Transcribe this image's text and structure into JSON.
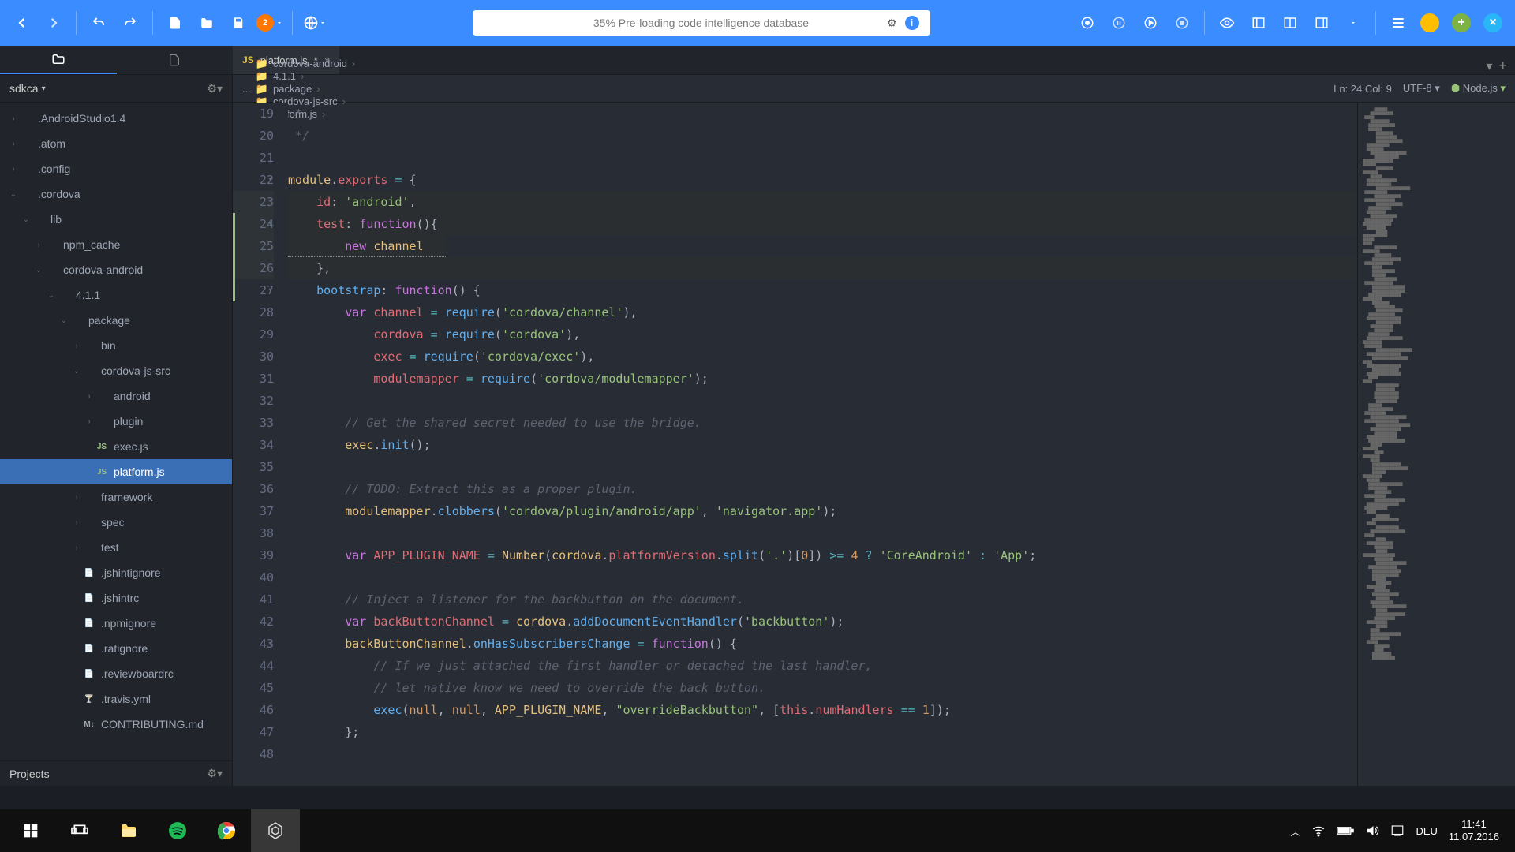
{
  "toolbar": {
    "loading_text": "35% Pre-loading code intelligence database",
    "update_badge": "2"
  },
  "tabs": {
    "file_name": "platform.js",
    "modified_marker": "*"
  },
  "sidebar": {
    "project_label": "sdkca",
    "footer_label": "Projects",
    "items": [
      {
        "label": ".AndroidStudio1.4",
        "depth": 0,
        "chev": "›",
        "icon": ""
      },
      {
        "label": ".atom",
        "depth": 0,
        "chev": "›",
        "icon": ""
      },
      {
        "label": ".config",
        "depth": 0,
        "chev": "›",
        "icon": ""
      },
      {
        "label": ".cordova",
        "depth": 0,
        "chev": "⌄",
        "icon": ""
      },
      {
        "label": "lib",
        "depth": 1,
        "chev": "⌄",
        "icon": ""
      },
      {
        "label": "npm_cache",
        "depth": 2,
        "chev": "›",
        "icon": ""
      },
      {
        "label": "cordova-android",
        "depth": 2,
        "chev": "⌄",
        "icon": ""
      },
      {
        "label": "4.1.1",
        "depth": 3,
        "chev": "⌄",
        "icon": ""
      },
      {
        "label": "package",
        "depth": 4,
        "chev": "⌄",
        "icon": ""
      },
      {
        "label": "bin",
        "depth": 5,
        "chev": "›",
        "icon": ""
      },
      {
        "label": "cordova-js-src",
        "depth": 5,
        "chev": "⌄",
        "icon": ""
      },
      {
        "label": "android",
        "depth": 6,
        "chev": "›",
        "icon": ""
      },
      {
        "label": "plugin",
        "depth": 6,
        "chev": "›",
        "icon": ""
      },
      {
        "label": "exec.js",
        "depth": 6,
        "chev": "",
        "icon": "JS",
        "iconColor": "#98c379"
      },
      {
        "label": "platform.js",
        "depth": 6,
        "chev": "",
        "icon": "JS",
        "iconColor": "#98c379",
        "selected": true
      },
      {
        "label": "framework",
        "depth": 5,
        "chev": "›",
        "icon": ""
      },
      {
        "label": "spec",
        "depth": 5,
        "chev": "›",
        "icon": ""
      },
      {
        "label": "test",
        "depth": 5,
        "chev": "›",
        "icon": ""
      },
      {
        "label": ".jshintignore",
        "depth": 5,
        "chev": "",
        "icon": "📄"
      },
      {
        "label": ".jshintrc",
        "depth": 5,
        "chev": "",
        "icon": "📄"
      },
      {
        "label": ".npmignore",
        "depth": 5,
        "chev": "",
        "icon": "📄"
      },
      {
        "label": ".ratignore",
        "depth": 5,
        "chev": "",
        "icon": "📄"
      },
      {
        "label": ".reviewboardrc",
        "depth": 5,
        "chev": "",
        "icon": "📄"
      },
      {
        "label": ".travis.yml",
        "depth": 5,
        "chev": "",
        "icon": "🍸",
        "iconColor": "#e06c75"
      },
      {
        "label": "CONTRIBUTING.md",
        "depth": 5,
        "chev": "",
        "icon": "M↓"
      }
    ]
  },
  "breadcrumb": {
    "segments": [
      "cordova-android",
      "4.1.1",
      "package",
      "cordova-js-src",
      "platform.js"
    ],
    "cursor_info": "Ln: 24 Col: 9",
    "encoding": "UTF-8",
    "language": "Node.js"
  },
  "editor": {
    "first_line": 19,
    "lines": [
      {
        "n": 19,
        "html": "<span class='com'> *</span>"
      },
      {
        "n": 20,
        "html": "<span class='com'> */</span>"
      },
      {
        "n": 21,
        "html": ""
      },
      {
        "n": 22,
        "fold": true,
        "html": "<span class='var2'>module</span>.<span class='prop'>exports</span> <span class='op'>=</span> {"
      },
      {
        "n": 23,
        "mod": true,
        "html": "    <span class='prop'>id</span>: <span class='str'>'android'</span>,"
      },
      {
        "n": 24,
        "fold": true,
        "mod": true,
        "cursor": true,
        "html": "    <span class='prop'>test</span>: <span class='kw'>function</span>(){"
      },
      {
        "n": 25,
        "mod": true,
        "underline": true,
        "html": "        <span class='kw'>new</span> <span class='var2'>channel</span>"
      },
      {
        "n": 26,
        "mod": true,
        "html": "    },"
      },
      {
        "n": 27,
        "fold": true,
        "html": "    <span class='fn'>bootstrap</span>: <span class='kw'>function</span>() {"
      },
      {
        "n": 28,
        "html": "        <span class='kw'>var</span> <span class='prop'>channel</span> <span class='op'>=</span> <span class='fn'>require</span>(<span class='str'>'cordova/channel'</span>),"
      },
      {
        "n": 29,
        "html": "            <span class='prop'>cordova</span> <span class='op'>=</span> <span class='fn'>require</span>(<span class='str'>'cordova'</span>),"
      },
      {
        "n": 30,
        "html": "            <span class='prop'>exec</span> <span class='op'>=</span> <span class='fn'>require</span>(<span class='str'>'cordova/exec'</span>),"
      },
      {
        "n": 31,
        "html": "            <span class='prop'>modulemapper</span> <span class='op'>=</span> <span class='fn'>require</span>(<span class='str'>'cordova/modulemapper'</span>);"
      },
      {
        "n": 32,
        "html": ""
      },
      {
        "n": 33,
        "html": "        <span class='com'>// Get the shared secret needed to use the bridge.</span>"
      },
      {
        "n": 34,
        "html": "        <span class='var2'>exec</span>.<span class='fn'>init</span>();"
      },
      {
        "n": 35,
        "html": ""
      },
      {
        "n": 36,
        "html": "        <span class='com'>// TODO: Extract this as a proper plugin.</span>"
      },
      {
        "n": 37,
        "html": "        <span class='var2'>modulemapper</span>.<span class='fn'>clobbers</span>(<span class='str'>'cordova/plugin/android/app'</span>, <span class='str'>'navigator.app'</span>);"
      },
      {
        "n": 38,
        "html": ""
      },
      {
        "n": 39,
        "html": "        <span class='kw'>var</span> <span class='prop'>APP_PLUGIN_NAME</span> <span class='op'>=</span> <span class='var2'>Number</span>(<span class='var2'>cordova</span>.<span class='prop'>platformVersion</span>.<span class='fn'>split</span>(<span class='str'>'.'</span>)[<span class='num'>0</span>]) <span class='op'>&gt;=</span> <span class='num'>4</span> <span class='op'>?</span> <span class='str'>'CoreAndroid'</span> <span class='op'>:</span> <span class='str'>'App'</span>;"
      },
      {
        "n": 40,
        "html": ""
      },
      {
        "n": 41,
        "html": "        <span class='com'>// Inject a listener for the backbutton on the document.</span>"
      },
      {
        "n": 42,
        "html": "        <span class='kw'>var</span> <span class='prop'>backButtonChannel</span> <span class='op'>=</span> <span class='var2'>cordova</span>.<span class='fn'>addDocumentEventHandler</span>(<span class='str'>'backbutton'</span>);"
      },
      {
        "n": 43,
        "fold": true,
        "html": "        <span class='var2'>backButtonChannel</span>.<span class='fn'>onHasSubscribersChange</span> <span class='op'>=</span> <span class='kw'>function</span>() {"
      },
      {
        "n": 44,
        "html": "            <span class='com'>// If we just attached the first handler or detached the last handler,</span>"
      },
      {
        "n": 45,
        "html": "            <span class='com'>// let native know we need to override the back button.</span>"
      },
      {
        "n": 46,
        "html": "            <span class='fn'>exec</span>(<span class='num'>null</span>, <span class='num'>null</span>, <span class='var2'>APP_PLUGIN_NAME</span>, <span class='str'>\"overrideBackbutton\"</span>, [<span class='this'>this</span>.<span class='prop'>numHandlers</span> <span class='op'>==</span> <span class='num'>1</span>]);"
      },
      {
        "n": 47,
        "html": "        };"
      },
      {
        "n": 48,
        "html": ""
      }
    ]
  },
  "taskbar": {
    "lang": "DEU",
    "time": "11:41",
    "date": "11.07.2016"
  }
}
